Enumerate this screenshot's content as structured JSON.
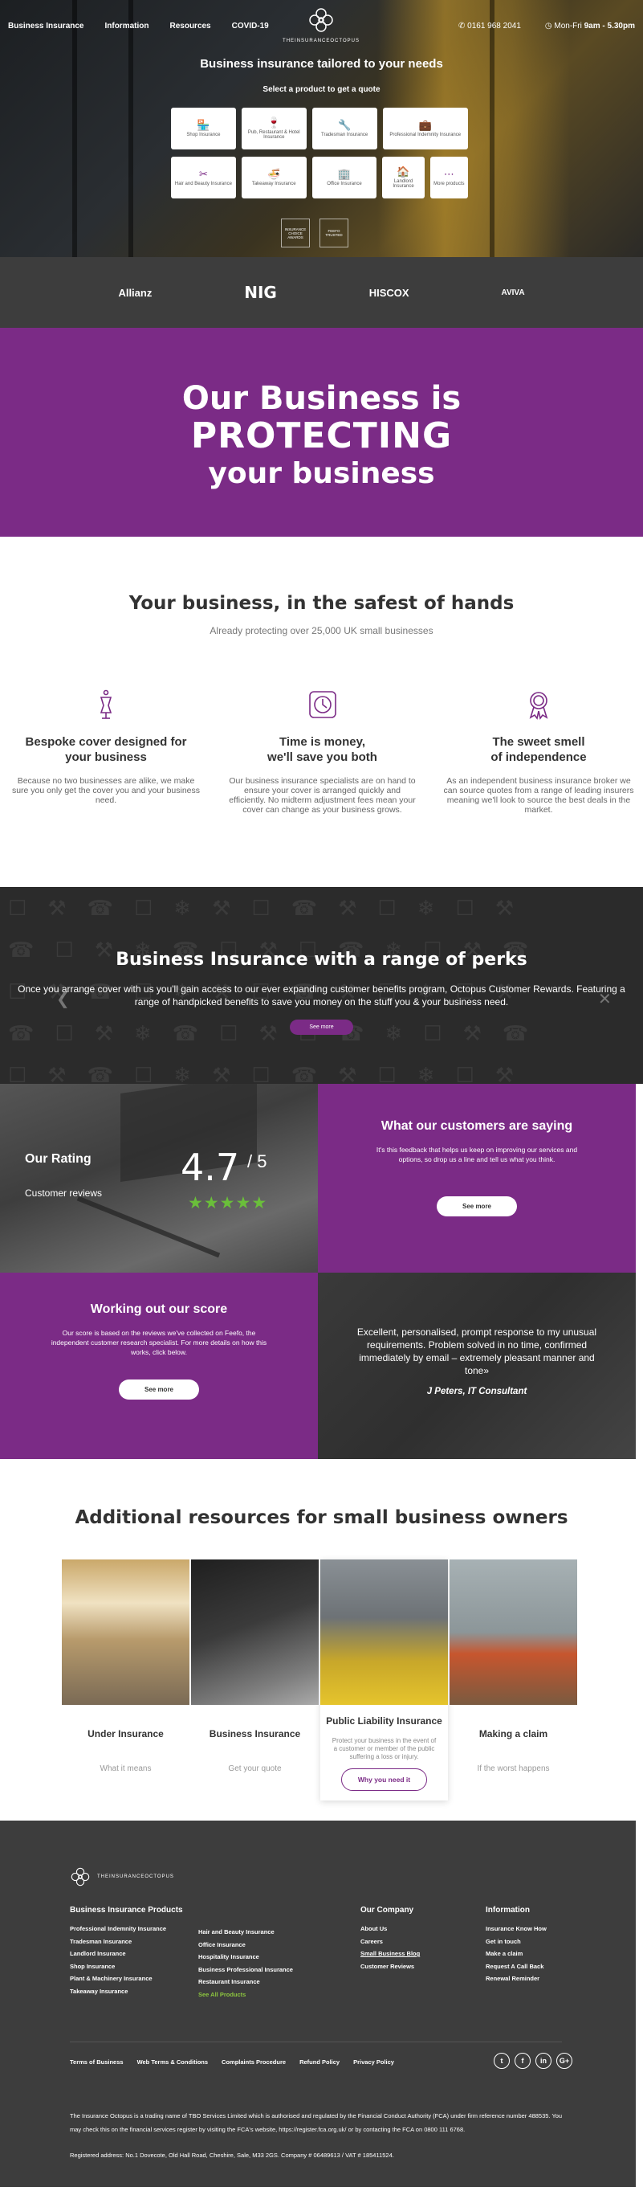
{
  "nav": {
    "links": [
      "Business Insurance",
      "Information",
      "Resources",
      "COVID-19"
    ],
    "brand": "THEINSURANCEOCTOPUS",
    "phone": "0161 968 2041",
    "hours_prefix": "Mon-Fri ",
    "hours_time": "9am - 5.30pm"
  },
  "hero": {
    "title": "Business insurance tailored to your needs",
    "subtitle": "Select a product to get a quote",
    "products_row1": [
      {
        "label": "Shop Insurance",
        "icon": "shop-icon"
      },
      {
        "label": "Pub, Restaurant & Hotel Insurance",
        "icon": "glass-icon"
      },
      {
        "label": "Tradesman Insurance",
        "icon": "wrench-icon"
      },
      {
        "label": "Professional Indemnity Insurance",
        "icon": "briefcase-icon"
      }
    ],
    "products_row2": [
      {
        "label": "Hair and Beauty Insurance",
        "icon": "scissors-icon"
      },
      {
        "label": "Takeaway Insurance",
        "icon": "takeaway-icon"
      },
      {
        "label": "Office Insurance",
        "icon": "office-icon"
      },
      {
        "label": "Landlord Insurance",
        "icon": "house-icon"
      },
      {
        "label": "More products",
        "icon": "more-icon"
      }
    ],
    "badges": [
      "INSURANCE CHOICE AWARDS",
      "FEEFO TRUSTED"
    ]
  },
  "insurers": [
    "Allianz",
    "NIG",
    "HISCOX",
    "AVIVA"
  ],
  "protect": {
    "line1": "Our Business is",
    "line2": "PROTECTING",
    "line3": "your business"
  },
  "safest": {
    "title": "Your business, in the safest of hands",
    "tagline": "Already protecting over 25,000 UK small businesses",
    "features": [
      {
        "title": "Bespoke cover designed for\nyour business",
        "text": "Because no two businesses are alike, we make sure you only get the cover you and your business need.",
        "icon": "mannequin-icon"
      },
      {
        "title": "Time is money,\nwe'll save you both",
        "text": "Our business insurance specialists are on hand to ensure your cover is arranged quickly and efficiently. No midterm adjustment fees mean your cover can change as your business grows.",
        "icon": "clock-icon"
      },
      {
        "title": "The sweet smell\nof independence",
        "text": "As an independent business insurance broker we can source quotes from a range of leading insurers meaning we'll look to source the best deals in the market.",
        "icon": "rosette-icon"
      }
    ]
  },
  "perks": {
    "title": "Business Insurance with a range of perks",
    "text": "Once you arrange cover with us you'll gain access to our ever expanding customer benefits program, Octopus Customer Rewards. Featuring a range of handpicked benefits to save you money on the stuff you & your business need.",
    "button": "See more"
  },
  "rating": {
    "title": "Our Rating",
    "reviews_label": "Customer reviews",
    "score": "4.7",
    "out_of": "/ 5",
    "stars": 5
  },
  "saying": {
    "title": "What our customers are saying",
    "text": "It's this feedback that helps us keep on improving our services and options, so drop us a line and tell us what you think.",
    "button": "See more"
  },
  "score_info": {
    "title": "Working out our score",
    "text": "Our score is based on the reviews we've collected on Feefo, the independent customer research specialist. For more details on how this works, click below.",
    "button": "See more"
  },
  "quote": {
    "text": "Excellent, personalised, prompt response to my unusual requirements. Problem solved in no time, confirmed immediately by email – extremely pleasant manner and tone»",
    "author": "J Peters, IT Consultant"
  },
  "resources": {
    "title": "Additional resources for small business owners",
    "cards": [
      {
        "title": "Under Insurance",
        "sub": "What it means"
      },
      {
        "title": "Business Insurance",
        "sub": "Get your quote"
      },
      {
        "title": "Public Liability Insurance",
        "text": "Protect your business in the event of a customer or member of the public suffering a loss or injury.",
        "button": "Why you need it"
      },
      {
        "title": "Making a claim",
        "sub": "If the worst happens"
      }
    ]
  },
  "footer": {
    "brand": "THEINSURANCEOCTOPUS",
    "col1": {
      "title": "Business Insurance Products",
      "items": [
        "Professional Indemnity Insurance",
        "Tradesman Insurance",
        "Landlord Insurance",
        "Shop Insurance",
        "Plant & Machinery Insurance",
        "Takeaway Insurance"
      ]
    },
    "col2": {
      "items": [
        "Hair and Beauty Insurance",
        "Office Insurance",
        "Hospitality Insurance",
        "Business Professional Insurance",
        "Restaurant Insurance",
        "See All Products"
      ]
    },
    "col3": {
      "title": "Our Company",
      "items": [
        "About Us",
        "Careers",
        "Small Business Blog",
        "Customer Reviews"
      ]
    },
    "col4": {
      "title": "Information",
      "items": [
        "Insurance Know How",
        "Get in touch",
        "Make a claim",
        "Request A Call Back",
        "Renewal Reminder"
      ]
    },
    "links": [
      "Terms of Business",
      "Web Terms & Conditions",
      "Complaints Procedure",
      "Refund Policy",
      "Privacy Policy"
    ],
    "social": [
      "t",
      "f",
      "in",
      "G+"
    ],
    "legal": "The Insurance Octopus is a trading name of TBO Services Limited which is authorised and regulated by the Financial Conduct Authority (FCA) under firm reference number 488535. You may check this on the financial services register by visiting the FCA's website, https://register.fca.org.uk/ or by contacting the FCA on 0800 111 6768.",
    "address": "Registered address: No.1 Dovecote, Old Hall Road, Cheshire, Sale, M33 2GS. Company # 06489613 / VAT # 185411524."
  },
  "colors": {
    "brand_purple": "#7b2b86",
    "dark": "#3d3d3d",
    "star_green": "#6abf3a"
  }
}
